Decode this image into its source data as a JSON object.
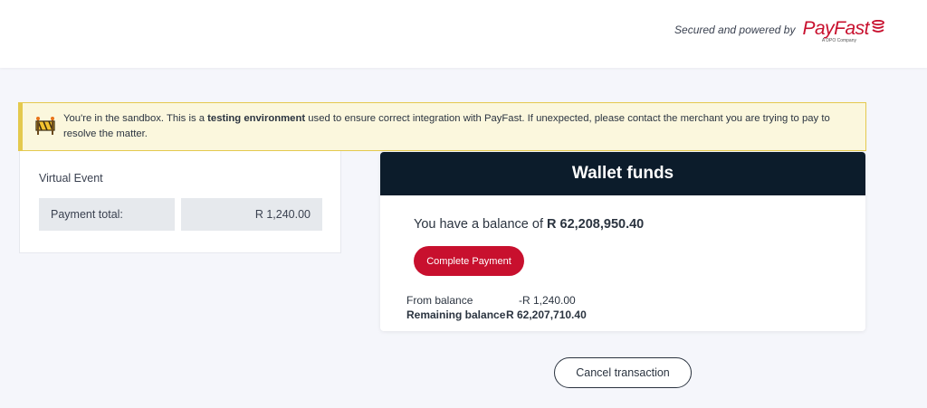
{
  "header": {
    "powered_text": "Secured and powered by",
    "logo_text": "PayFast",
    "logo_subtext": "A DPO Company"
  },
  "banner": {
    "text_before": "You're in the sandbox. This is a ",
    "text_bold": "testing environment",
    "text_after": " used to ensure correct integration with PayFast. If unexpected, please contact the merchant you are trying to pay to resolve the matter."
  },
  "order": {
    "item_name": "Virtual Event",
    "total_label": "Payment total:",
    "total_value": "R 1,240.00"
  },
  "wallet": {
    "title": "Wallet funds",
    "balance_prefix": "You have a balance of ",
    "balance_value": "R 62,208,950.40",
    "pay_button": "Complete Payment",
    "from_label": "From balance",
    "from_value": "-R 1,240.00",
    "remaining_label": "Remaining balance",
    "remaining_value": "R 62,207,710.40"
  },
  "actions": {
    "cancel_button": "Cancel transaction"
  },
  "colors": {
    "brand_red": "#c8102e",
    "header_navy": "#0c1c2b",
    "banner_bg": "#fbf7dd",
    "banner_border": "#e4c94e"
  },
  "icons": {
    "banner_icon": "sandbox-sign-icon",
    "logo_icon": "payfast-coins-icon"
  }
}
